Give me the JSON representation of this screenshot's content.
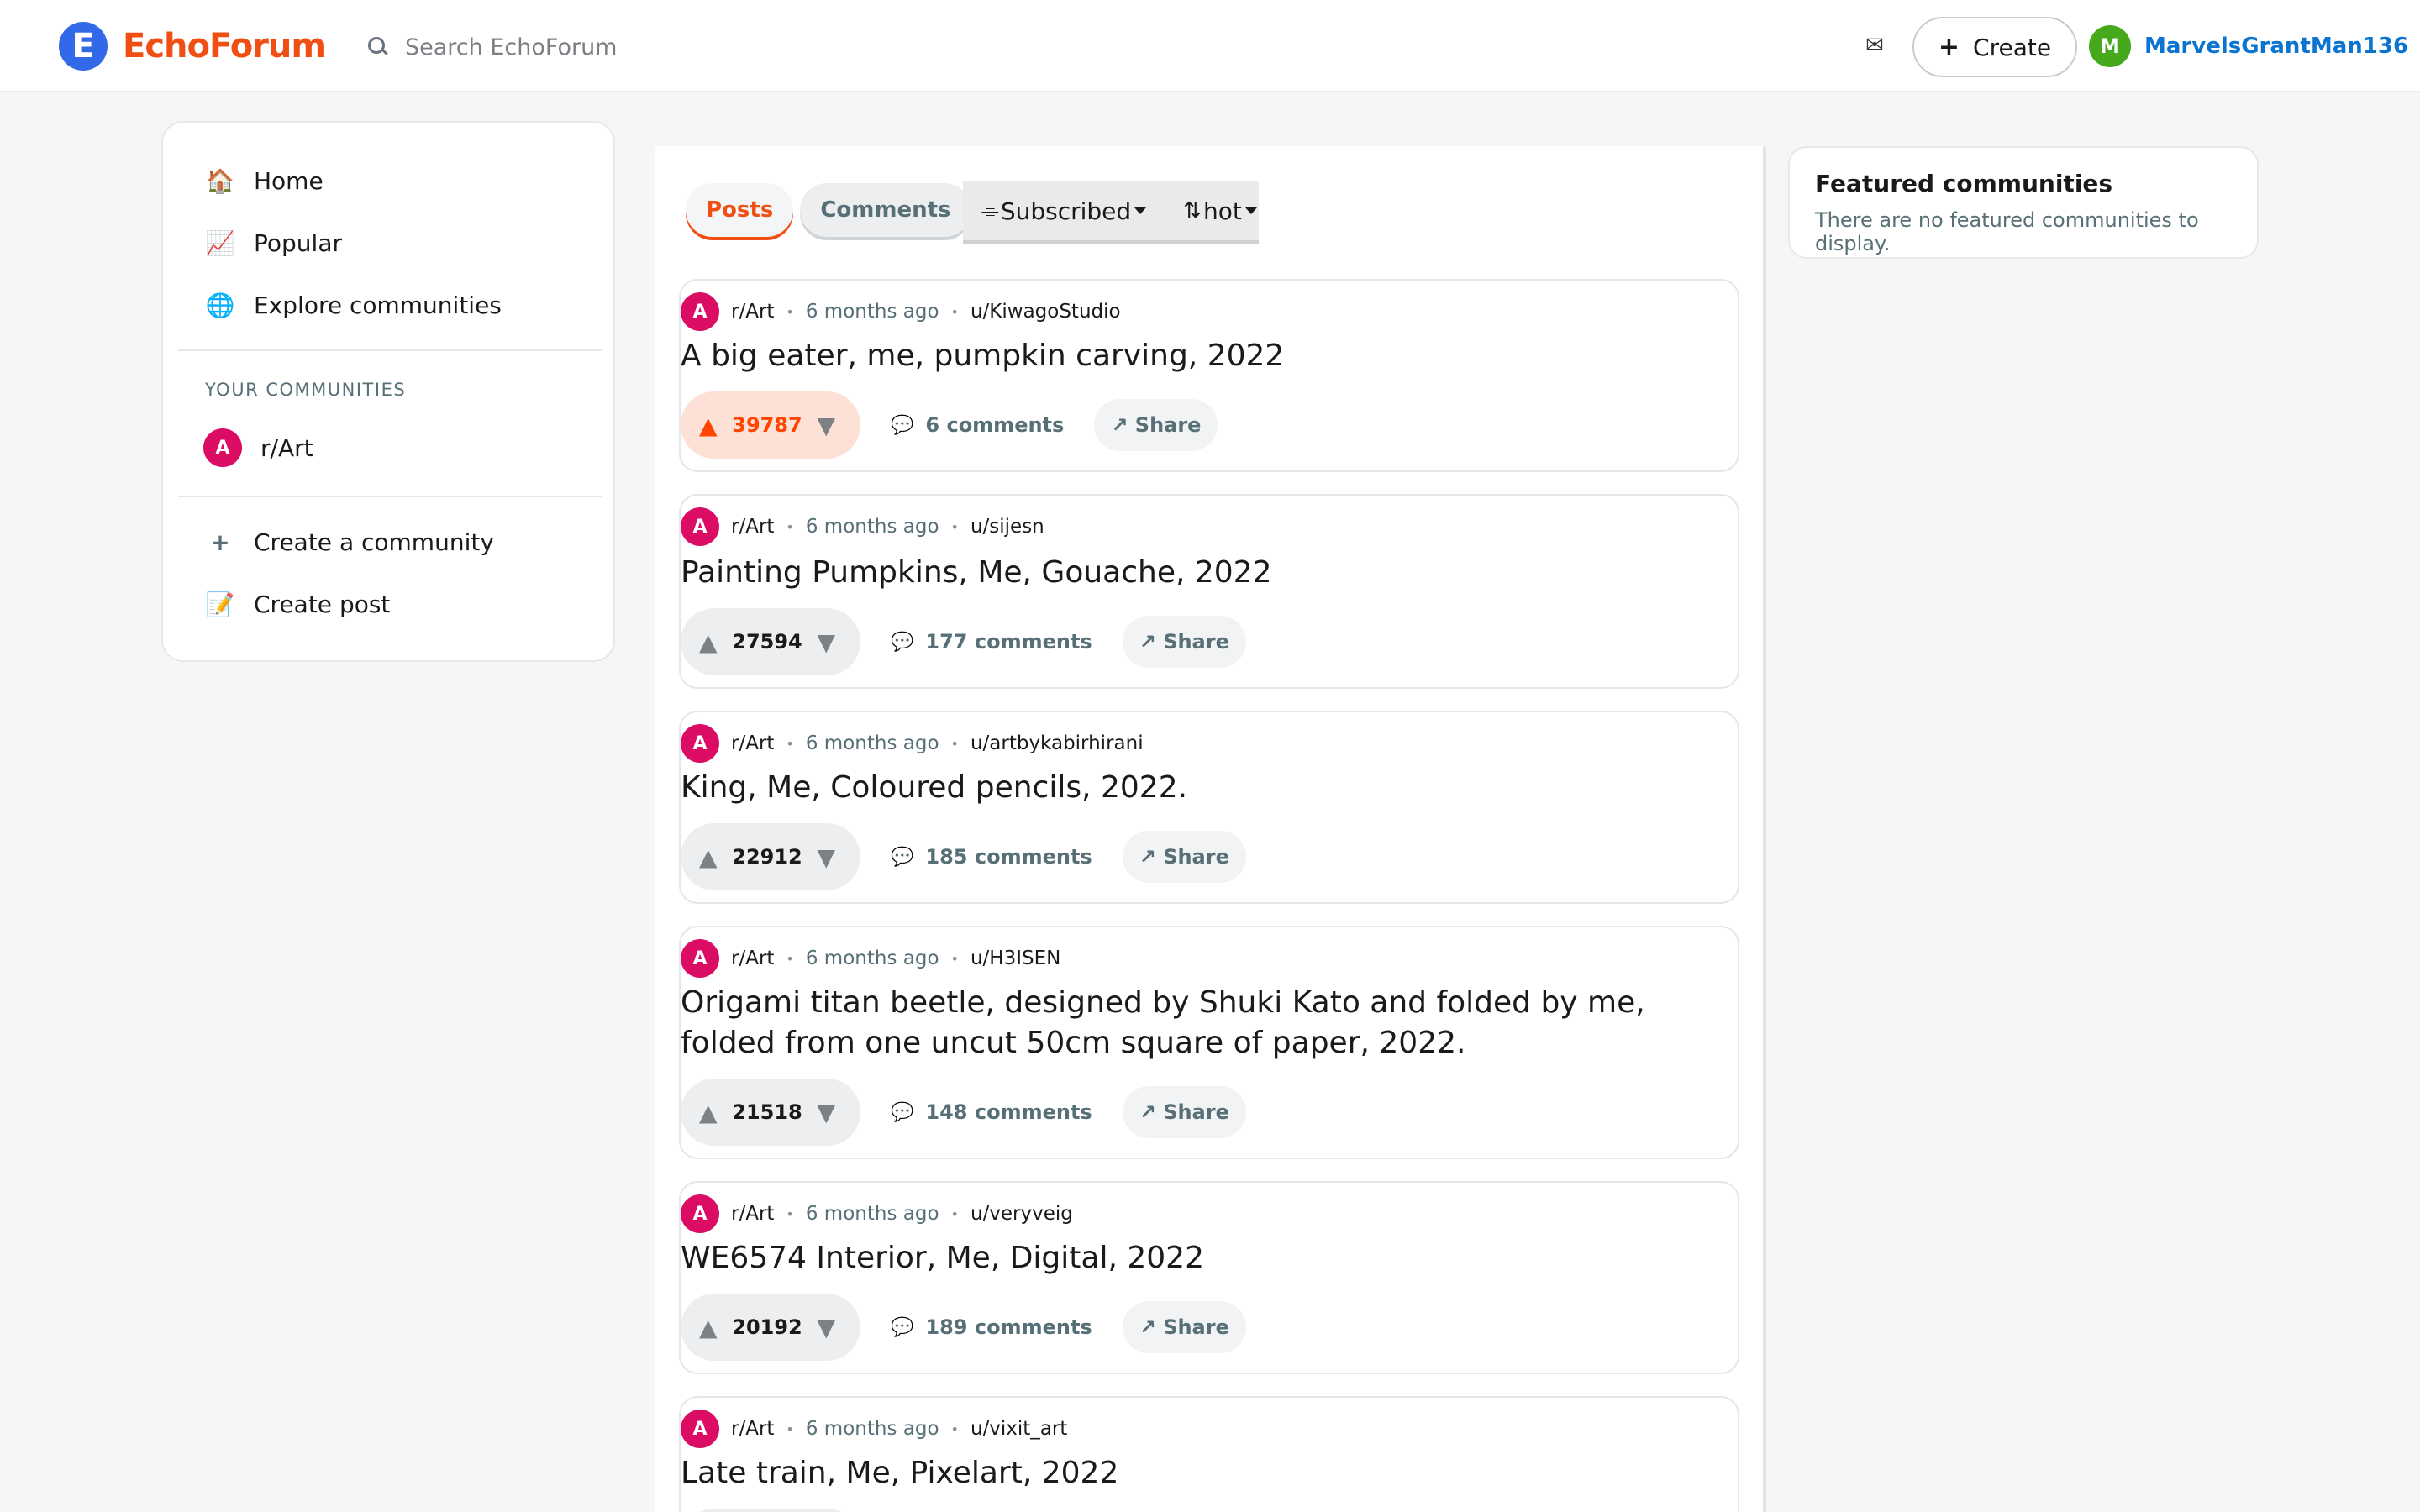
{
  "brand": {
    "logo_letter": "E",
    "name": "EchoForum",
    "color": "#f04f13"
  },
  "search": {
    "placeholder": "Search EchoForum"
  },
  "header": {
    "mail_icon": "✉",
    "create_label": "Create",
    "user": {
      "avatar_letter": "M",
      "username": "MarvelsGrantMan136"
    }
  },
  "sidebar": {
    "nav": [
      {
        "icon": "🏠",
        "label": "Home"
      },
      {
        "icon": "📈",
        "label": "Popular"
      },
      {
        "icon": "🌐",
        "label": "Explore communities"
      }
    ],
    "your_communities_label": "YOUR COMMUNITIES",
    "communities": [
      {
        "avatar_letter": "A",
        "name": "r/Art"
      }
    ],
    "actions": [
      {
        "icon": "+",
        "label": "Create a community"
      },
      {
        "icon": "📝",
        "label": "Create post"
      }
    ]
  },
  "feed": {
    "tabs": [
      {
        "label": "Posts",
        "active": true
      },
      {
        "label": "Comments",
        "active": false
      }
    ],
    "filters": [
      {
        "icon": "⌯",
        "label": "Subscribed"
      },
      {
        "icon": "⇅",
        "label": "hot"
      }
    ],
    "share_label": "Share",
    "posts": [
      {
        "community": "r/Art",
        "avatar_letter": "A",
        "time": "6 months ago",
        "author": "u/KiwagoStudio",
        "title": "A big eater, me, pumpkin carving, 2022",
        "score": "39787",
        "comments": "6 comments",
        "upvoted": true
      },
      {
        "community": "r/Art",
        "avatar_letter": "A",
        "time": "6 months ago",
        "author": "u/sijesn",
        "title": "Painting Pumpkins, Me, Gouache, 2022",
        "score": "27594",
        "comments": "177 comments",
        "upvoted": false
      },
      {
        "community": "r/Art",
        "avatar_letter": "A",
        "time": "6 months ago",
        "author": "u/artbykabirhirani",
        "title": "King, Me, Coloured pencils, 2022.",
        "score": "22912",
        "comments": "185 comments",
        "upvoted": false
      },
      {
        "community": "r/Art",
        "avatar_letter": "A",
        "time": "6 months ago",
        "author": "u/H3ISEN",
        "title": "Origami titan beetle, designed by Shuki Kato and folded by me, folded from one uncut 50cm square of paper, 2022.",
        "score": "21518",
        "comments": "148 comments",
        "upvoted": false
      },
      {
        "community": "r/Art",
        "avatar_letter": "A",
        "time": "6 months ago",
        "author": "u/veryveig",
        "title": "WE6574 Interior, Me, Digital, 2022",
        "score": "20192",
        "comments": "189 comments",
        "upvoted": false
      },
      {
        "community": "r/Art",
        "avatar_letter": "A",
        "time": "6 months ago",
        "author": "u/vixit_art",
        "title": "Late train, Me, Pixelart, 2022",
        "score": "",
        "comments": "",
        "upvoted": false
      }
    ]
  },
  "featured": {
    "title": "Featured communities",
    "empty_text": "There are no featured communities to display."
  }
}
